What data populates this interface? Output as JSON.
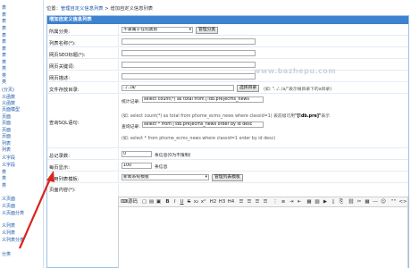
{
  "sidebar": {
    "items": [
      {
        "label": "表"
      },
      {
        "label": "表"
      },
      {
        "label": "表"
      },
      {
        "label": "表"
      },
      {
        "label": "表"
      },
      {
        "label": "表"
      },
      {
        "label": "表"
      },
      {
        "label": "表"
      },
      {
        "label": "类"
      },
      {
        "label": "类"
      },
      {
        "label": "类"
      },
      {
        "label": "类"
      },
      {
        "label": "(分页)"
      },
      {
        "label": "义函数"
      },
      {
        "label": "义函数"
      },
      {
        "label": "页面模型"
      },
      {
        "label": "页面"
      },
      {
        "label": "页面"
      },
      {
        "label": "页面"
      },
      {
        "label": "页面"
      },
      {
        "label": "列表"
      },
      {
        "label": "列表"
      },
      {
        "label": "义字段"
      },
      {
        "label": "义字段"
      },
      {
        "label": "类"
      },
      {
        "label": "类"
      },
      {
        "label": "类"
      },
      {
        "label": "义页面"
      },
      {
        "label": "义页面"
      },
      {
        "label": "义页面分类"
      },
      {
        "label": "义列表"
      },
      {
        "label": "义列表"
      },
      {
        "label": "义列表分类"
      },
      {
        "label": "分类"
      }
    ]
  },
  "breadcrumb": {
    "prefix": "位置：",
    "link1": "管理自定义信息列表",
    "sep": " > ",
    "link2": "增加自定义信息列表"
  },
  "panel": {
    "title": "增加自定义信息列表"
  },
  "watermark": "www.bazhepu.com",
  "form": {
    "category": {
      "label": "所属分类:",
      "value": "不隶属于任何类别",
      "btn": "管理分类"
    },
    "name": {
      "label": "列表名称(*):"
    },
    "seo_title": {
      "label": "网页SEO标题(*):"
    },
    "keywords": {
      "label": "网页关键词:"
    },
    "description": {
      "label": "网页描述:"
    },
    "dir": {
      "label": "文件存放目录:",
      "value": "../../a/",
      "btn": "选择目录",
      "hint": "(如: \"../../a/\"表示根目录下的a目录)"
    },
    "sql": {
      "label": "查询SQL语句:",
      "count_label": "统计记录:",
      "count_value": "select count(*) as total from [!db.pre]ecms_news",
      "count_hint_pre": "(如: select count(*) as total from phome_ecms_news where classid=1) 表前缀可用",
      "count_hint_bold": "\"[!db.pre]\"",
      "count_hint_post": "表示",
      "query_label": "查询记录:",
      "query_value": "select * from [!db.pre]ecms_news order by id desc",
      "query_hint": "(如: select * from phome_ecms_news where classid=1 order by id desc)"
    },
    "total": {
      "label": "总记录数:",
      "value": "0",
      "unit": "条信息(0为不限制)"
    },
    "per_page": {
      "label": "每页显示:",
      "value": "100",
      "unit": "条信息"
    },
    "template": {
      "label": "使用列表模板:",
      "value": "新闻系统模板",
      "btn": "管理列表模板"
    },
    "content": {
      "label": "页面内容(*):"
    }
  },
  "toolbar": {
    "source": "源码",
    "bold": "B",
    "italic": "I",
    "underline": "U",
    "strike": "S",
    "h2": "H2",
    "h3": "H3",
    "h4": "H4",
    "quote": "\"\""
  },
  "colors": {
    "accent": "#3d82cf",
    "arrow": "#d9261c",
    "link": "#1a57a8"
  }
}
